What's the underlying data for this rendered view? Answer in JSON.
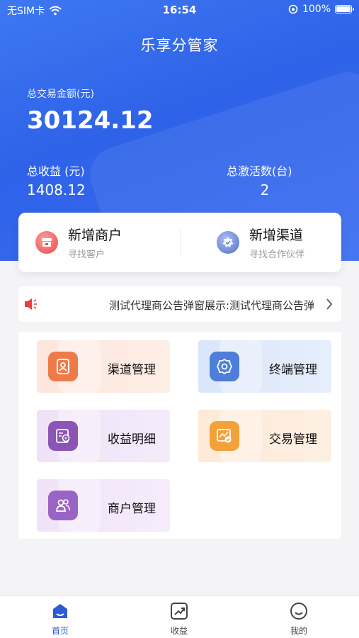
{
  "status_bar": {
    "carrier": "无SIM卡",
    "time": "16:54",
    "battery": "100%"
  },
  "app_title": "乐享分管家",
  "summary": {
    "total_amount_label": "总交易金额(元)",
    "total_amount": "30124.12",
    "income_label": "总收益 (元)",
    "income": "1408.12",
    "activation_label": "总激活数(台)",
    "activation": "2"
  },
  "quick_actions": [
    {
      "title": "新增商户",
      "subtitle": "寻找客户",
      "icon": "merchant-icon",
      "color": "#e84c4c"
    },
    {
      "title": "新增渠道",
      "subtitle": "寻找合作伙伴",
      "icon": "channel-badge-icon",
      "color": "#5570c8"
    }
  ],
  "notice": {
    "text": "测试代理商公告弹窗展示:测试代理商公告弹"
  },
  "menu": [
    {
      "label": "渠道管理",
      "icon": "contact-book-icon",
      "color": "#ef7a49"
    },
    {
      "label": "终端管理",
      "icon": "gear-icon",
      "color": "#4d7ed9"
    },
    {
      "label": "收益明细",
      "icon": "receipt-icon",
      "color": "#8a55b5"
    },
    {
      "label": "交易管理",
      "icon": "chart-check-icon",
      "color": "#f4a13c"
    },
    {
      "label": "商户管理",
      "icon": "users-icon",
      "color": "#9a64c4"
    }
  ],
  "tabs": [
    {
      "label": "首页",
      "icon": "home-icon",
      "active": true
    },
    {
      "label": "收益",
      "icon": "trend-icon",
      "active": false
    },
    {
      "label": "我的",
      "icon": "smile-icon",
      "active": false
    }
  ],
  "colors": {
    "primary": "#2e62e8",
    "tab_active": "#2d5bd3"
  }
}
